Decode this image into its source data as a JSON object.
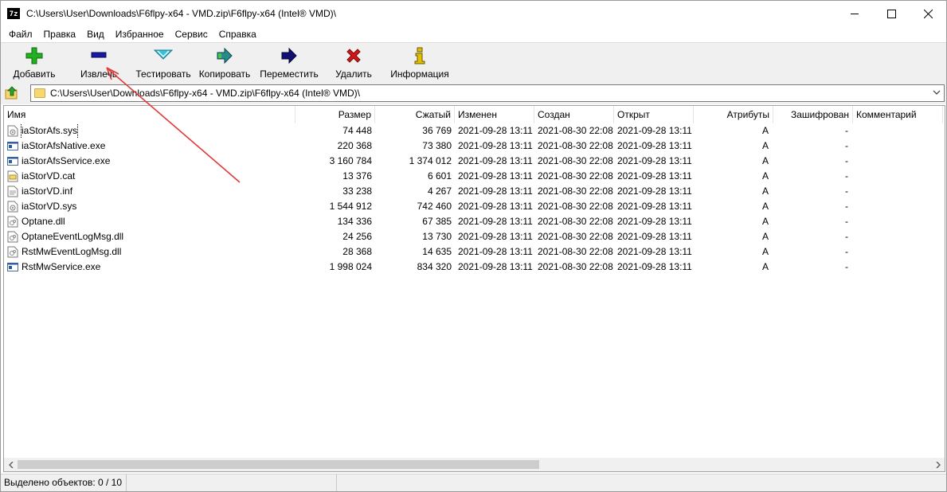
{
  "window": {
    "title": "C:\\Users\\User\\Downloads\\F6flpy-x64 - VMD.zip\\F6flpy-x64 (Intel® VMD)\\",
    "app_icon_text": "7z"
  },
  "menu": [
    "Файл",
    "Правка",
    "Вид",
    "Избранное",
    "Сервис",
    "Справка"
  ],
  "toolbar": [
    {
      "label": "Добавить",
      "icon": "plus-icon",
      "color": "#22b022"
    },
    {
      "label": "Извлечь",
      "icon": "minus-icon",
      "color": "#1a1aa0"
    },
    {
      "label": "Тестировать",
      "icon": "check-icon",
      "color": "#38c0d8"
    },
    {
      "label": "Копировать",
      "icon": "copy-arrow-icon",
      "color": "#2a8a8a"
    },
    {
      "label": "Переместить",
      "icon": "move-arrow-icon",
      "color": "#101070"
    },
    {
      "label": "Удалить",
      "icon": "delete-x-icon",
      "color": "#d01818"
    },
    {
      "label": "Информация",
      "icon": "info-icon",
      "color": "#e0c000"
    }
  ],
  "address": {
    "path": "C:\\Users\\User\\Downloads\\F6flpy-x64 - VMD.zip\\F6flpy-x64 (Intel® VMD)\\"
  },
  "columns": [
    "Имя",
    "Размер",
    "Сжатый",
    "Изменен",
    "Создан",
    "Открыт",
    "Атрибуты",
    "Зашифрован",
    "Комментарий"
  ],
  "files": [
    {
      "name": "iaStorAfs.sys",
      "type": "sys",
      "size": "74 448",
      "packed": "36 769",
      "modified": "2021-09-28 13:11",
      "created": "2021-08-30 22:08",
      "accessed": "2021-09-28 13:11",
      "attributes": "A",
      "encrypted": "-",
      "comment": ""
    },
    {
      "name": "iaStorAfsNative.exe",
      "type": "exe",
      "size": "220 368",
      "packed": "73 380",
      "modified": "2021-09-28 13:11",
      "created": "2021-08-30 22:08",
      "accessed": "2021-09-28 13:11",
      "attributes": "A",
      "encrypted": "-",
      "comment": ""
    },
    {
      "name": "iaStorAfsService.exe",
      "type": "exe",
      "size": "3 160 784",
      "packed": "1 374 012",
      "modified": "2021-09-28 13:11",
      "created": "2021-08-30 22:08",
      "accessed": "2021-09-28 13:11",
      "attributes": "A",
      "encrypted": "-",
      "comment": ""
    },
    {
      "name": "iaStorVD.cat",
      "type": "cat",
      "size": "13 376",
      "packed": "6 601",
      "modified": "2021-09-28 13:11",
      "created": "2021-08-30 22:08",
      "accessed": "2021-09-28 13:11",
      "attributes": "A",
      "encrypted": "-",
      "comment": ""
    },
    {
      "name": "iaStorVD.inf",
      "type": "inf",
      "size": "33 238",
      "packed": "4 267",
      "modified": "2021-09-28 13:11",
      "created": "2021-08-30 22:08",
      "accessed": "2021-09-28 13:11",
      "attributes": "A",
      "encrypted": "-",
      "comment": ""
    },
    {
      "name": "iaStorVD.sys",
      "type": "sys",
      "size": "1 544 912",
      "packed": "742 460",
      "modified": "2021-09-28 13:11",
      "created": "2021-08-30 22:08",
      "accessed": "2021-09-28 13:11",
      "attributes": "A",
      "encrypted": "-",
      "comment": ""
    },
    {
      "name": "Optane.dll",
      "type": "dll",
      "size": "134 336",
      "packed": "67 385",
      "modified": "2021-09-28 13:11",
      "created": "2021-08-30 22:08",
      "accessed": "2021-09-28 13:11",
      "attributes": "A",
      "encrypted": "-",
      "comment": ""
    },
    {
      "name": "OptaneEventLogMsg.dll",
      "type": "dll",
      "size": "24 256",
      "packed": "13 730",
      "modified": "2021-09-28 13:11",
      "created": "2021-08-30 22:08",
      "accessed": "2021-09-28 13:11",
      "attributes": "A",
      "encrypted": "-",
      "comment": ""
    },
    {
      "name": "RstMwEventLogMsg.dll",
      "type": "dll",
      "size": "28 368",
      "packed": "14 635",
      "modified": "2021-09-28 13:11",
      "created": "2021-08-30 22:08",
      "accessed": "2021-09-28 13:11",
      "attributes": "A",
      "encrypted": "-",
      "comment": ""
    },
    {
      "name": "RstMwService.exe",
      "type": "exe",
      "size": "1 998 024",
      "packed": "834 320",
      "modified": "2021-09-28 13:11",
      "created": "2021-08-30 22:08",
      "accessed": "2021-09-28 13:11",
      "attributes": "A",
      "encrypted": "-",
      "comment": ""
    }
  ],
  "status": {
    "selection": "Выделено объектов: 0 / 10"
  },
  "colors": {
    "annotation_arrow": "#e03a3a",
    "toolbar_bg": "#f0f0f0"
  }
}
